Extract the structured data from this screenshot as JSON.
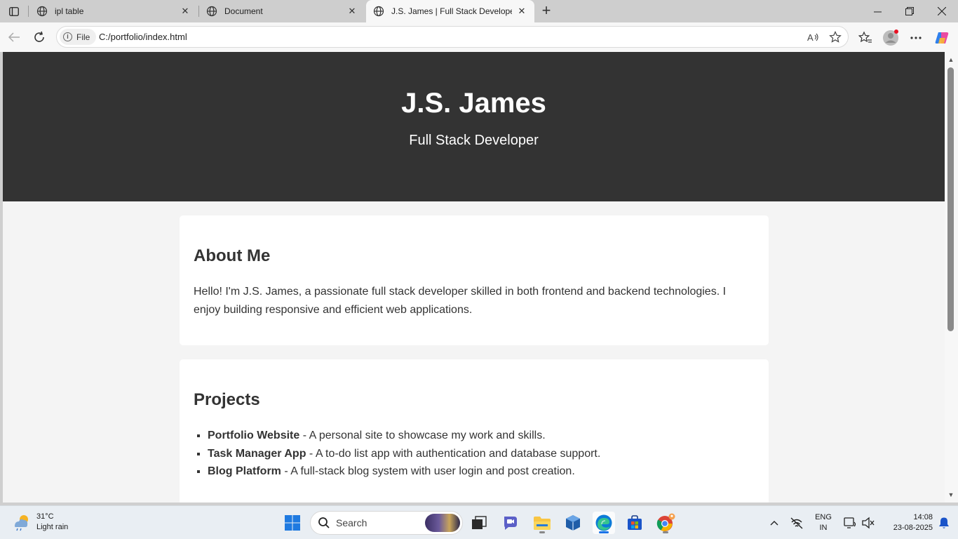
{
  "browser": {
    "tabs": [
      {
        "title": "ipl table",
        "active": false
      },
      {
        "title": "Document",
        "active": false
      },
      {
        "title": "J.S. James | Full Stack Developer",
        "active": true
      }
    ],
    "site_chip": "File",
    "url": "C:/portfolio/index.html"
  },
  "page": {
    "hero": {
      "name": "J.S. James",
      "tagline": "Full Stack Developer"
    },
    "about": {
      "heading": "About Me",
      "text": "Hello! I'm J.S. James, a passionate full stack developer skilled in both frontend and backend technologies. I enjoy building responsive and efficient web applications."
    },
    "projects": {
      "heading": "Projects",
      "items": [
        {
          "name": "Portfolio Website",
          "desc": " - A personal site to showcase my work and skills."
        },
        {
          "name": "Task Manager App",
          "desc": " - A to-do list app with authentication and database support."
        },
        {
          "name": "Blog Platform",
          "desc": " - A full-stack blog system with user login and post creation."
        }
      ]
    }
  },
  "taskbar": {
    "weather": {
      "temp": "31°C",
      "condition": "Light rain"
    },
    "search_placeholder": "Search",
    "language": {
      "line1": "ENG",
      "line2": "IN"
    },
    "clock": {
      "time": "14:08",
      "date": "23-08-2025"
    }
  },
  "colors": {
    "hero_bg": "#333333",
    "page_bg": "#f4f4f4",
    "card_bg": "#ffffff",
    "text": "#333333",
    "edge_blue": "#1a73e8"
  },
  "icons": [
    "tab-actions-icon",
    "globe-icon",
    "close-icon",
    "new-tab-icon",
    "minimize-icon",
    "maximize-icon",
    "window-close-icon",
    "back-icon",
    "refresh-icon",
    "info-icon",
    "read-aloud-icon",
    "favorite-star-icon",
    "favorites-icon",
    "profile-icon",
    "more-icon",
    "copilot-icon",
    "weather-icon",
    "windows-start-icon",
    "search-icon",
    "task-view-icon",
    "meet-icon",
    "file-explorer-icon",
    "virtualbox-icon",
    "edge-icon",
    "store-icon",
    "chrome-icon",
    "chevron-up-icon",
    "network-off-icon",
    "display-icon",
    "notification-bell-icon"
  ]
}
